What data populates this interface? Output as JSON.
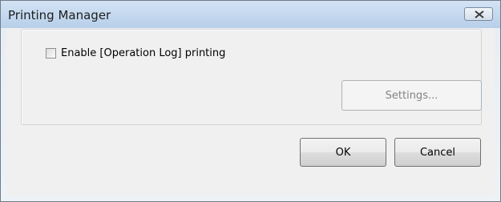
{
  "window": {
    "title": "Printing Manager",
    "close_icon": "close-icon"
  },
  "options": {
    "enable_log_printing": {
      "label": "Enable [Operation Log] printing",
      "checked": false
    }
  },
  "buttons": {
    "settings": "Settings...",
    "ok": "OK",
    "cancel": "Cancel"
  }
}
